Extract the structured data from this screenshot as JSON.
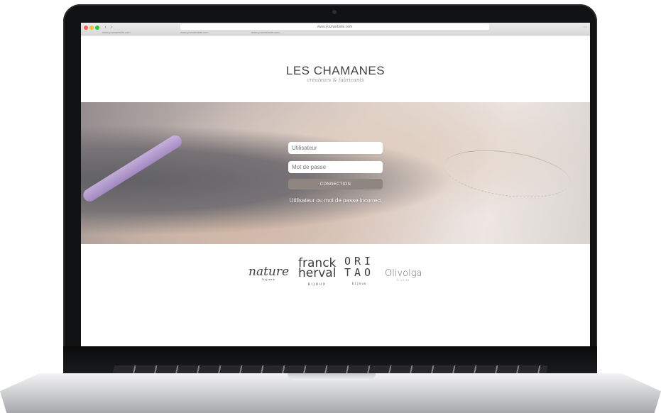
{
  "browser": {
    "address": "www.yourwebsite.com",
    "tabs": [
      "www.yourwebsite.com",
      "www.yourwebsite.com",
      "www.yourwebsite.com"
    ]
  },
  "brand": {
    "title": "LES CHAMANES",
    "tagline": "créateurs & fabricants"
  },
  "login": {
    "username_placeholder": "Utilisateur",
    "password_placeholder": "Mot de passe",
    "submit_label": "CONNECTION",
    "error_message": "Utilisateur ou mot de passe incorrect"
  },
  "logos": {
    "nature": {
      "name": "nature",
      "sub": "bijoux"
    },
    "franck": {
      "line1": "franck",
      "line2": "herval",
      "sub": "BIJOUX"
    },
    "oritao": {
      "line1": "ORI",
      "line2": "TAO",
      "sub": "bijoux"
    },
    "olivolga": {
      "name": "Olivolga",
      "sub": "bijoux"
    }
  }
}
